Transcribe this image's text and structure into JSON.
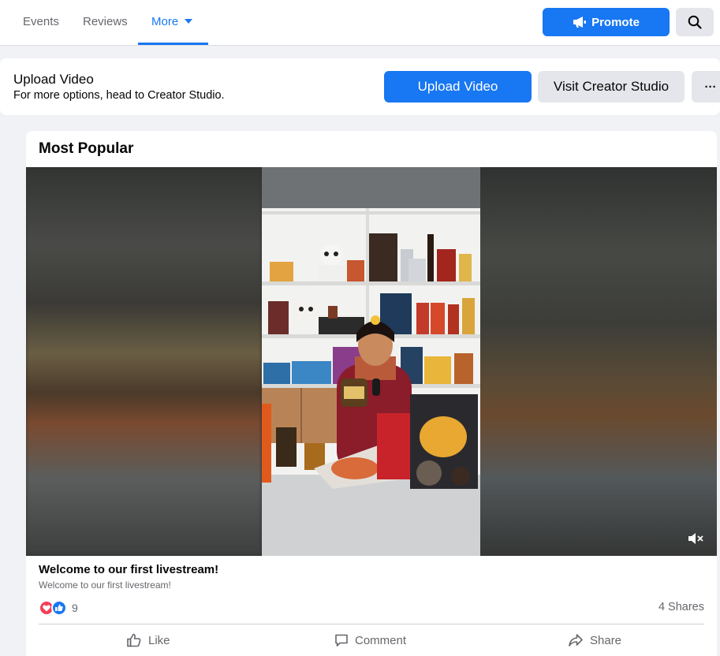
{
  "tabs": [
    {
      "label": "Events"
    },
    {
      "label": "Reviews"
    },
    {
      "label": "More"
    }
  ],
  "header": {
    "promote_label": "Promote",
    "search_icon": "search-icon"
  },
  "upload": {
    "title": "Upload Video",
    "subtitle": "For more options, head to Creator Studio.",
    "upload_button": "Upload Video",
    "creator_button": "Visit Creator Studio",
    "more_label": "···"
  },
  "section": {
    "title": "Most Popular"
  },
  "post": {
    "title": "Welcome to our first livestream!",
    "description": "Welcome to our first livestream!",
    "reaction_count": "9",
    "shares": "4 Shares",
    "like_label": "Like",
    "comment_label": "Comment",
    "share_label": "Share",
    "muted": true
  },
  "colors": {
    "accent": "#1877f2",
    "secondary_text": "#65676b",
    "love": "#f33e58"
  }
}
